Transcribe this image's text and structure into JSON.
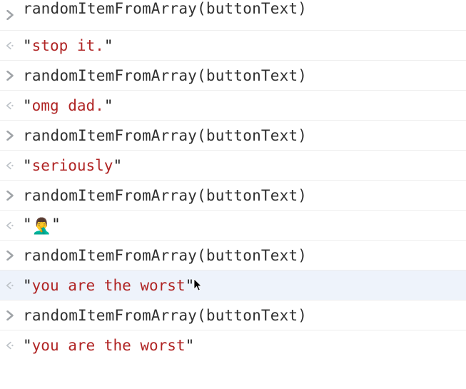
{
  "console": {
    "entries": [
      {
        "type": "input",
        "text": "randomItemFromArray(buttonText)",
        "partial": true
      },
      {
        "type": "output",
        "value": "stop it."
      },
      {
        "type": "input",
        "text": "randomItemFromArray(buttonText)"
      },
      {
        "type": "output",
        "value": "omg dad."
      },
      {
        "type": "input",
        "text": "randomItemFromArray(buttonText)"
      },
      {
        "type": "output",
        "value": "seriously"
      },
      {
        "type": "input",
        "text": "randomItemFromArray(buttonText)"
      },
      {
        "type": "output",
        "value": "🤦‍♂️",
        "facepalm": true
      },
      {
        "type": "input",
        "text": "randomItemFromArray(buttonText)"
      },
      {
        "type": "output",
        "value": "you are the worst",
        "highlighted": true,
        "cursor": true
      },
      {
        "type": "input",
        "text": "randomItemFromArray(buttonText)"
      },
      {
        "type": "output",
        "value": "you are the worst"
      }
    ]
  },
  "icons": {
    "inputArrowColor": "#a0a4a8",
    "outputArrowColor": "#bfc4c9"
  }
}
